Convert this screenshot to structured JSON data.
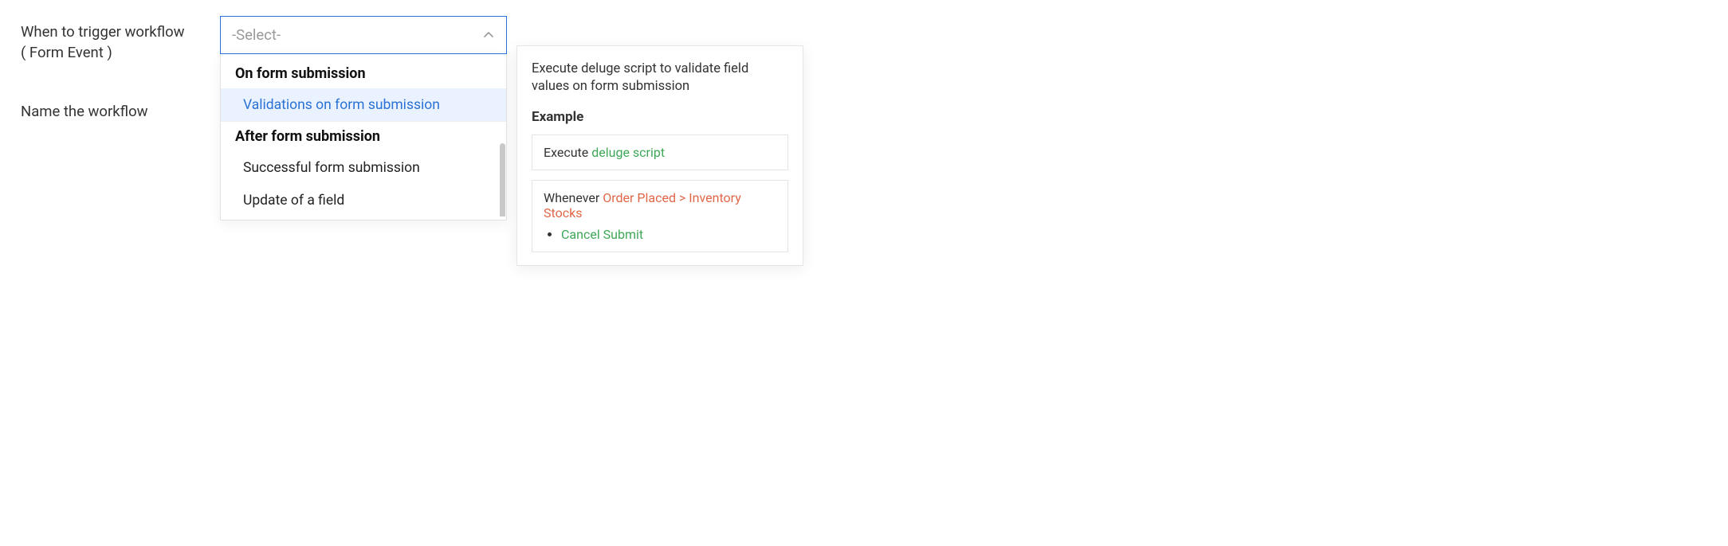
{
  "labels": {
    "trigger_line1": "When to trigger workflow",
    "trigger_line2": "( Form Event )",
    "name_workflow": "Name the workflow"
  },
  "select": {
    "placeholder": "-Select-"
  },
  "dropdown": {
    "group_on_submission": "On form submission",
    "item_validations": "Validations on form submission",
    "group_after_submission": "After form submission",
    "item_successful": "Successful form submission",
    "item_update_field": "Update of a field"
  },
  "info": {
    "description": "Execute deluge script to validate field values on form submission",
    "heading": "Example",
    "box1_prefix": "Execute ",
    "box1_green": "deluge script",
    "box2_prefix": "Whenever ",
    "box2_red": "Order Placed > Inventory Stocks",
    "box2_bullet": "Cancel Submit"
  }
}
